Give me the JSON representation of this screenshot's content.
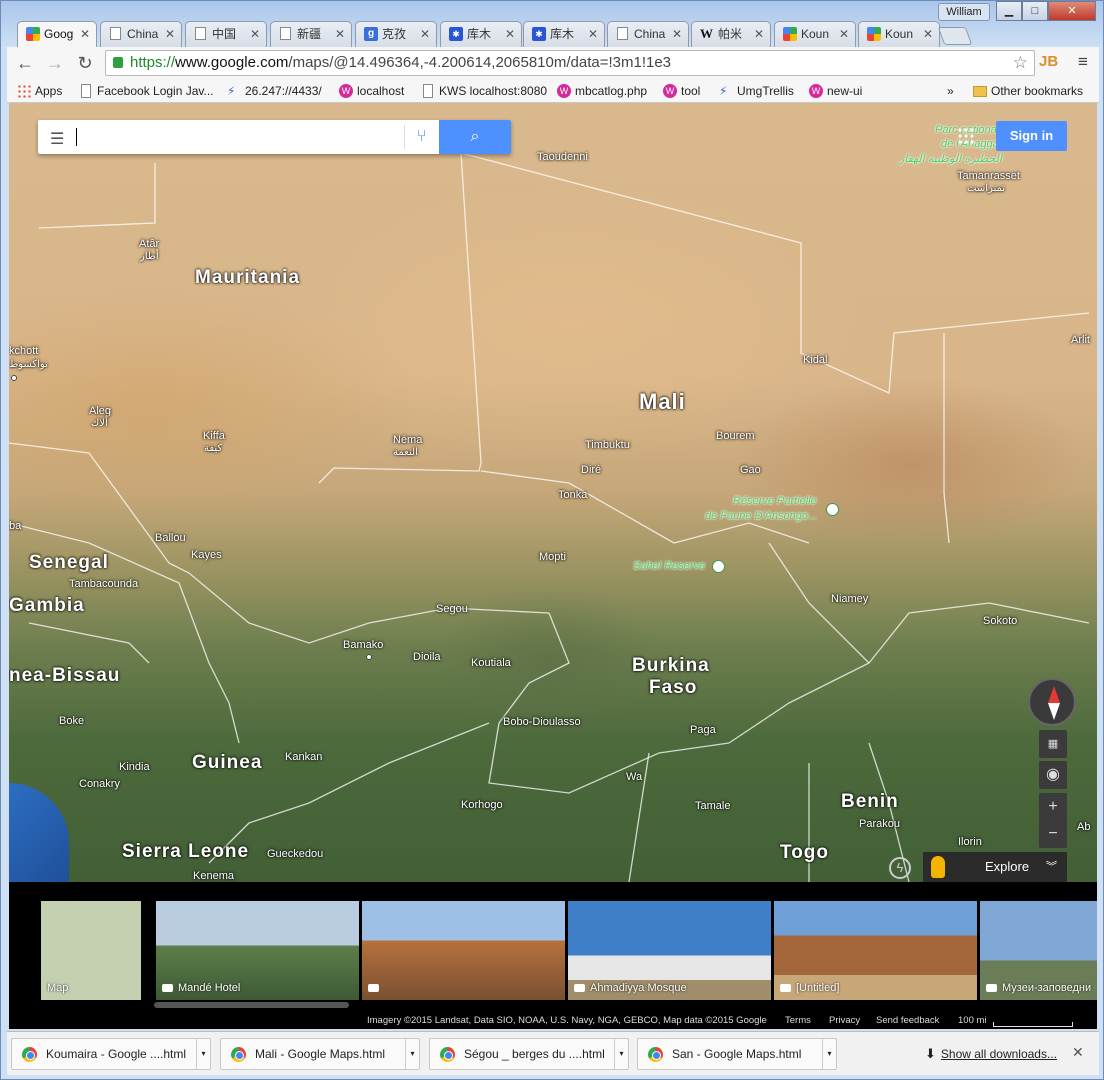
{
  "window": {
    "user": "William",
    "min": "▁",
    "max": "□",
    "close": "✕"
  },
  "tabs": [
    {
      "label": "Goog",
      "icon": "maps-icon",
      "active": true
    },
    {
      "label": "China",
      "icon": "document-icon"
    },
    {
      "label": "中国",
      "icon": "document-icon"
    },
    {
      "label": "新疆",
      "icon": "document-icon"
    },
    {
      "label": "克孜",
      "icon": "google-icon"
    },
    {
      "label": "库木",
      "icon": "baidu-icon"
    },
    {
      "label": "库木",
      "icon": "baidu-icon"
    },
    {
      "label": "China",
      "icon": "document-icon"
    },
    {
      "label": "帕米",
      "icon": "wikipedia-icon"
    },
    {
      "label": "Koun",
      "icon": "maps-icon"
    },
    {
      "label": "Koun",
      "icon": "maps-icon"
    }
  ],
  "toolbar": {
    "url_scheme": "https://",
    "url_host": "www.google.com",
    "url_path": "/maps/@14.496364,-4.200614,2065810m/data=!3m1!1e3",
    "ext_label": "JB"
  },
  "bookmarks": [
    {
      "label": "Apps",
      "icon": "apps-icon"
    },
    {
      "label": "Facebook Login Jav...",
      "icon": "document-icon"
    },
    {
      "label": "26.247://4433/",
      "icon": "link-icon"
    },
    {
      "label": "localhost",
      "icon": "w-icon"
    },
    {
      "label": "KWS localhost:8080",
      "icon": "document-icon"
    },
    {
      "label": "mbcatlog.php",
      "icon": "w-icon"
    },
    {
      "label": "tool",
      "icon": "w-icon"
    },
    {
      "label": "UmgTrellis",
      "icon": "link-icon"
    },
    {
      "label": "new-ui",
      "icon": "w-icon"
    }
  ],
  "bookmarks_overflow": "»",
  "other_bookmarks": "Other bookmarks",
  "maps": {
    "search_placeholder": "",
    "sign_in": "Sign in",
    "explore": "Explore",
    "labels": {
      "mauritania": "Mauritania",
      "mali": "Mali",
      "senegal": "Senegal",
      "gambia": "Gambia",
      "guinea_bissau": "nea-Bissau",
      "guinea": "Guinea",
      "sierra_leone": "Sierra Leone",
      "burkina1": "Burkina",
      "burkina2": "Faso",
      "benin": "Benin",
      "togo": "Togo",
      "taoudenni": "Taoudenni",
      "atar": "Atâr",
      "atar_ar": "أطار",
      "nouakchott": "kchott",
      "nouakchott_ar": "نواكشوط",
      "aleg": "Aleg",
      "aleg_ar": "ألاك",
      "kiffa": "Kiffa",
      "kiffa_ar": "كيفة",
      "nema": "Néma",
      "nema_ar": "النعمة",
      "timbuktu": "Timbuktu",
      "bourem": "Bourem",
      "dire": "Diré",
      "gao": "Gao",
      "tonka": "Tonka",
      "kidal": "Kidal",
      "arlit": "Arlit",
      "tamanrasset": "Tamanrasset",
      "tamanrasset_ar": "تمنراست",
      "park_ahaggar1": "Parc national",
      "park_ahaggar2": "de l'Ahaggar",
      "park_ahaggar_ar": "الحظيرة الوطنية الهقار",
      "park_ansongo1": "Réserve Partielle",
      "park_ansongo2": "de Faune D'Ansongo...",
      "sahel": "Sahel Reserve",
      "ballou": "Ballou",
      "kayes": "Kayes",
      "tambacounda": "Tambacounda",
      "ba": "ba",
      "mopti": "Mopti",
      "segou": "Segou",
      "bamako": "Bamako",
      "dioila": "Dioila",
      "koutiala": "Koutiala",
      "niamey": "Niamey",
      "sokoto": "Sokoto",
      "boke": "Boke",
      "bobo": "Bobo-Dioulasso",
      "paga": "Paga",
      "kankan": "Kankan",
      "kindia": "Kindia",
      "conakry": "Conakry",
      "wa": "Wa",
      "korhogo": "Korhogo",
      "tamale": "Tamale",
      "parakou": "Parakou",
      "ilorin": "Ilorin",
      "ab": "Ab",
      "gueckedou": "Gueckedou",
      "kenema": "Kenema"
    },
    "thumbnails": [
      {
        "caption": "Map",
        "camera": false,
        "bg": "#b9c7a4"
      },
      {
        "caption": "Mandé Hotel",
        "camera": true,
        "bg": "#8aa0b8"
      },
      {
        "caption": "",
        "camera": true,
        "bg": "#b06b3d"
      },
      {
        "caption": "Ahmadiyya Mosque",
        "camera": true,
        "bg": "#4f86c6"
      },
      {
        "caption": "[Untitled]",
        "camera": true,
        "bg": "#a2673c"
      },
      {
        "caption": "Музеи-заповедни",
        "camera": true,
        "bg": "#6a8fc0"
      }
    ],
    "footer": {
      "imagery": "Imagery ©2015 Landsat, Data SIO, NOAA, U.S. Navy, NGA, GEBCO, Map data ©2015 Google",
      "terms": "Terms",
      "privacy": "Privacy",
      "feedback": "Send feedback",
      "scale": "100 mi"
    }
  },
  "downloads": {
    "items": [
      "Koumaira - Google ....html",
      "Mali - Google Maps.html",
      "Ségou _ berges du ....html",
      "San - Google Maps.html"
    ],
    "show_all": "Show all downloads...",
    "close": "✕"
  }
}
